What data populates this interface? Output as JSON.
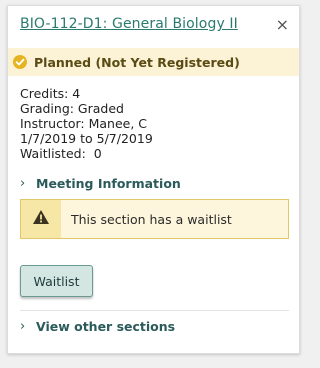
{
  "header": {
    "title": "BIO-112-D1: General Biology II",
    "close_glyph": "×"
  },
  "status": {
    "text": "Planned (Not Yet Registered)",
    "icon": "check-circle-icon",
    "icon_color": "#e6b422"
  },
  "details": {
    "credits": "Credits: 4",
    "grading": "Grading: Graded",
    "instructor": "Instructor: Manee, C",
    "dates": "1/7/2019 to 5/7/2019",
    "waitlisted": "Waitlisted:  0"
  },
  "meeting": {
    "label": "Meeting Information",
    "chevron": "›"
  },
  "warning": {
    "text": "This section has a waitlist",
    "icon": "warning-triangle-icon"
  },
  "actions": {
    "waitlist_label": "Waitlist"
  },
  "other_sections": {
    "label": "View other sections",
    "chevron": "›"
  },
  "colors": {
    "title": "#2b7a6f",
    "status_bg": "#fcf3d6",
    "warning_border": "#e0c76a",
    "button_bg": "#d4e6e2"
  }
}
